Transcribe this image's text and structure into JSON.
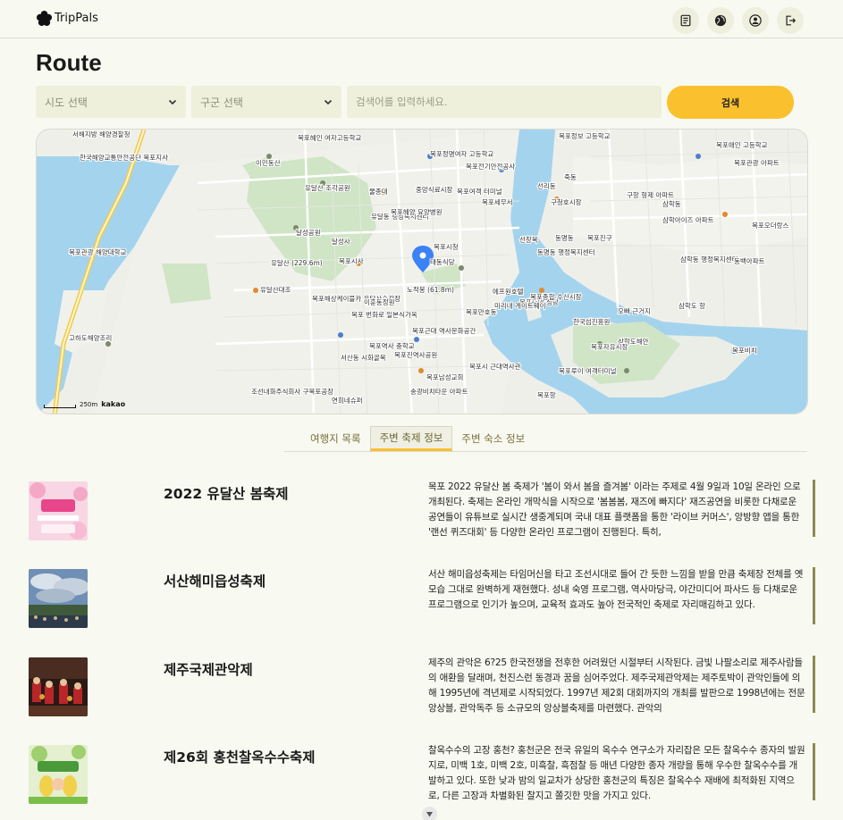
{
  "header": {
    "brand": "TripPals",
    "icons": [
      "note-icon",
      "globe-icon",
      "user-icon",
      "logout-icon"
    ]
  },
  "page": {
    "title": "Route"
  },
  "filters": {
    "sido_label": "시도 선택",
    "gugun_label": "구군 선택",
    "search_placeholder": "검색어를 입력하세요.",
    "search_button": "검색"
  },
  "map": {
    "scale_label": "250m",
    "brand": "kakao",
    "labels": [
      "서해지방 해양경찰청",
      "한국해양교통안전공단 목포지사",
      "목포혜인 여자고등학교",
      "이민동산",
      "유달산 조각공원",
      "달성공원",
      "달성사",
      "유달산 (229.6m)",
      "목포시사",
      "목포해상케이블카 유달산승강장",
      "유달산대조",
      "목포 번화로 일본식가옥",
      "목포근대 역사문화공간",
      "목포역사 충학교",
      "서산동 시화골목",
      "조선내화주식회사 구목포공장",
      "송광비치타운 아파트",
      "연희네슈퍼",
      "목포남성교회",
      "노적봉 (61.8m)",
      "목포진역사공원",
      "목포시 근대역사관",
      "목포중앙 성당",
      "목포정명여자 고등학교",
      "목포전기안전공사",
      "목포세무서",
      "목포여객 터미널",
      "죽동",
      "선리동",
      "구항 형제 아파트",
      "삼학아이즈 아파트",
      "삼학동",
      "삼학동 행정복지센터",
      "목포종합 수산시장",
      "미리내 게이트웨이",
      "한국섬진흥원",
      "삼학도해안",
      "목포항",
      "고하도해양조리",
      "목포시청",
      "목포정보 고등학교",
      "동명동 행정복지센터",
      "동명동",
      "구청호시장",
      "유달동 행정복지센터",
      "목포혜양 요양병원",
      "물종대",
      "중앙식료시장",
      "이훈동정원",
      "목포만호동",
      "에프원호텔",
      "목포진구",
      "선창목",
      "태동식당",
      "목포자유시장",
      "오빠 근거지",
      "목포루이 여객터미널",
      "삼학도 항",
      "동백아파트",
      "목포오더랑스",
      "목포관광 아파트",
      "목포애인 고등학교",
      "목포관광 해양대학교",
      "목포비치"
    ]
  },
  "tabs": [
    {
      "label": "여행지 목록",
      "active": false
    },
    {
      "label": "주변 축제 정보",
      "active": true
    },
    {
      "label": "주변 숙소 정보",
      "active": false
    }
  ],
  "festivals": [
    {
      "name": "2022 유달산 봄축제",
      "thumb": "spring-poster",
      "description": "목포 2022 유달산 봄 축제가 '봄이 와서 봄을 즐겨봄' 이라는 주제로 4월 9일과 10일 온라인 으로 개최된다. 축제는 온라인 개막식을 시작으로 '봄봄봄, 재즈에 빠지다' 재즈공연을 비롯한 다채로운 공연들이 유튜브로 실시간 생중계되며 국내 대표 플랫폼을 통한 '라이브 커머스', 앙방향 앱을 통한 '랜선 퀴즈대회' 등 다양한 온라인 프로그램이 진행된다. 특히,"
    },
    {
      "name": "서산해미읍성축제",
      "thumb": "castle-crowd",
      "description": "서산 해미읍성축제는 타임머신을 타고 조선시대로 들어 간 듯한 느낌을 받을 만큼 축제장 전체를 옛 모습 그대로 완벽하게 재현했다. 성내 숙영 프로그램, 역사마당극, 야간미디어 파사드 등 다채로운 프로그램으로 인기가 높으며, 교육적 효과도 높아 전국적인 축제로 자리매김하고 있다."
    },
    {
      "name": "제주국제관악제",
      "thumb": "brass-band",
      "description": "제주의 관악은 6?25 한국전쟁을 전후한 어려웠던 시절부터 시작된다. 금빛 나팔소리로 제주사람들의 애환을 달래며, 천진스런 동경과 꿈을 심어주었다. 제주국제관악제는 제주토박이 관악인들에 의해 1995년에 격년제로 시작되었다. 1997년 제2회 대회까지의 개최를 발판으로 1998년에는 전문앙상블, 관악독주 등 소규모의 앙상블축제를 마련했다. 관악의"
    },
    {
      "name": "제26회 홍천찰옥수수축제",
      "thumb": "corn-poster",
      "description": "찰옥수수의 고장 홍천? 홍천군은 전국 유일의 옥수수 연구소가 자리잡은 모든 찰옥수수 종자의 발원지로, 미백 1호, 미백 2호, 미흑찰, 흑점찰 등 매년 다양한 종자 개량을 통해 우수한 찰옥수수를 개발하고 있다. 또한 낮과 밤의 일교차가 상당한 홍천군의 특징은 찰옥수수 재배에 최적화된 지역으로, 다른 고장과 차별화된 찰지고 쫄깃한 맛을 가지고 있다."
    }
  ],
  "colors": {
    "accent": "#fbc02d",
    "field": "#eef0dc",
    "tab_text": "#79713a",
    "desc_bar": "#8c8a52"
  }
}
